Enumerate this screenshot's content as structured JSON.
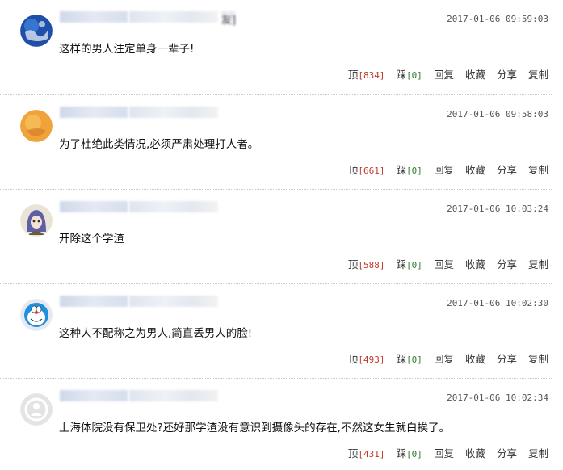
{
  "comments": [
    {
      "avatar": "globe-avatar",
      "name_suffix": "友]",
      "time": "2017-01-06 09:59:03",
      "text": "这样的男人注定单身一辈子!",
      "actions": {
        "up_label": "顶",
        "up_count": "[834]",
        "down_label": "踩",
        "down_count": "[0]",
        "reply": "回复",
        "collect": "收藏",
        "share": "分享",
        "copy": "复制"
      }
    },
    {
      "avatar": "orange-avatar",
      "name_suffix": "",
      "time": "2017-01-06 09:58:03",
      "text": "为了杜绝此类情况,必须严肃处理打人者。",
      "actions": {
        "up_label": "顶",
        "up_count": "[661]",
        "down_label": "踩",
        "down_count": "[0]",
        "reply": "回复",
        "collect": "收藏",
        "share": "分享",
        "copy": "复制"
      }
    },
    {
      "avatar": "anime-girl-avatar",
      "name_suffix": "",
      "time": "2017-01-06 10:03:24",
      "text": "开除这个学渣",
      "actions": {
        "up_label": "顶",
        "up_count": "[588]",
        "down_label": "踩",
        "down_count": "[0]",
        "reply": "回复",
        "collect": "收藏",
        "share": "分享",
        "copy": "复制"
      }
    },
    {
      "avatar": "doraemon-avatar",
      "name_suffix": "",
      "time": "2017-01-06 10:02:30",
      "text": "这种人不配称之为男人,简直丢男人的脸!",
      "actions": {
        "up_label": "顶",
        "up_count": "[493]",
        "down_label": "踩",
        "down_count": "[0]",
        "reply": "回复",
        "collect": "收藏",
        "share": "分享",
        "copy": "复制"
      }
    },
    {
      "avatar": "default-user-avatar",
      "name_suffix": "",
      "time": "2017-01-06 10:02:34",
      "text": "上海体院没有保卫处?还好那学渣没有意识到摄像头的存在,不然这女生就白挨了。",
      "actions": {
        "up_label": "顶",
        "up_count": "[431]",
        "down_label": "踩",
        "down_count": "[0]",
        "reply": "回复",
        "collect": "收藏",
        "share": "分享",
        "copy": "复制"
      }
    }
  ]
}
